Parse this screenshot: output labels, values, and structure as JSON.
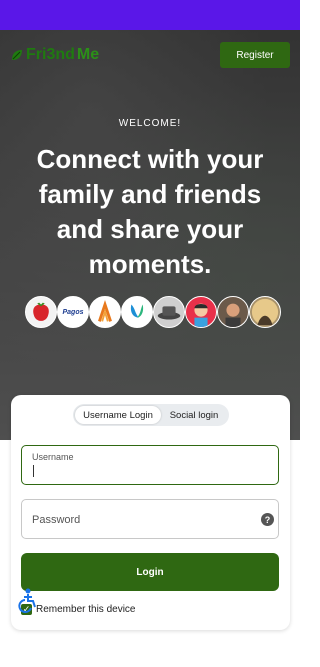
{
  "header": {
    "logo_text_a": "Fri3nd",
    "logo_text_b": "Me",
    "register_label": "Register"
  },
  "hero": {
    "welcome": "WELCOME!",
    "headline": "Connect with your family and friends and share your moments."
  },
  "avatars": [
    {
      "name": "strawberry-avatar",
      "label": ""
    },
    {
      "name": "pagos-avatar",
      "label": "Pagos"
    },
    {
      "name": "ers-avatar",
      "label": "ERS"
    },
    {
      "name": "univsense-avatar",
      "label": "UnivSense"
    },
    {
      "name": "hat-avatar",
      "label": ""
    },
    {
      "name": "cartoon-avatar",
      "label": ""
    },
    {
      "name": "man-avatar",
      "label": ""
    },
    {
      "name": "silhouette-avatar",
      "label": ""
    }
  ],
  "login": {
    "tab_username": "Username Login",
    "tab_social": "Social login",
    "username_label": "Username",
    "password_placeholder": "Password",
    "help_glyph": "?",
    "login_label": "Login",
    "remember_label": "Remember this device"
  },
  "colors": {
    "status_bar": "#5a17e8",
    "brand_green": "#2f6812"
  }
}
